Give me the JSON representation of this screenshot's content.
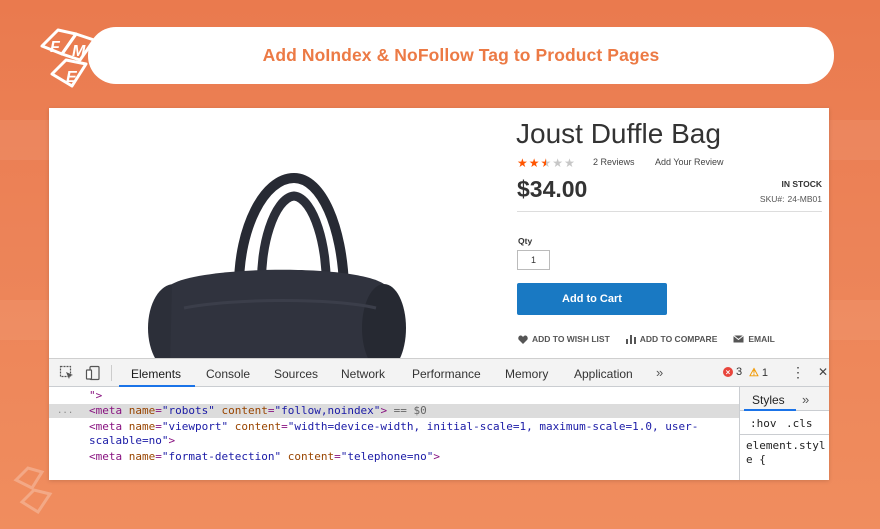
{
  "header": {
    "title": "Add NoIndex & NoFollow Tag to Product Pages"
  },
  "colors": {
    "accent": "#ec7a45",
    "button": "#1979c3",
    "star_on": "#ff5501",
    "devtools_tab_underline": "#1a73e8"
  },
  "product": {
    "name": "Joust Duffle Bag",
    "rating_stars_filled": 2.5,
    "rating_stars_total": 5,
    "reviews_label": "2  Reviews",
    "add_review_label": "Add Your Review",
    "price": "$34.00",
    "stock": "IN STOCK",
    "sku_label": "SKU#:",
    "sku_value": "24-MB01",
    "qty_label": "Qty",
    "qty_value": "1",
    "add_to_cart": "Add to Cart",
    "actions": {
      "wishlist": "ADD TO WISH LIST",
      "compare": "ADD TO COMPARE",
      "email": "EMAIL"
    }
  },
  "devtools": {
    "tabs": [
      "Elements",
      "Console",
      "Sources",
      "Network",
      "Performance",
      "Memory",
      "Application"
    ],
    "more": "»",
    "error_count": "3",
    "warning_count": "1",
    "dom": {
      "line0": "\">",
      "line1": {
        "tag_open": "<meta ",
        "attr1": "name",
        "val1": "\"robots\"",
        "attr2": "content",
        "val2": "\"follow,noindex\"",
        "tag_close": ">",
        "marker": " == $0"
      },
      "line2": {
        "tag_open": "<meta ",
        "attr1": "name",
        "val1": "\"viewport\"",
        "attr2": "content",
        "val2": "\"width=device-width, initial-scale=1, maximum-scale=1.0, user-",
        "cont": "scalable=no\"",
        "tag_close": ">"
      },
      "line3": {
        "tag_open": "<meta ",
        "attr1": "name",
        "val1": "\"format-detection\"",
        "attr2": "content",
        "val2": "\"telephone=no\"",
        "tag_close": ">"
      },
      "dots": "..."
    },
    "styles": {
      "tab": "Styles",
      "more": "»",
      "hov": ":hov",
      "cls": ".cls",
      "rule": "element.style {"
    }
  }
}
